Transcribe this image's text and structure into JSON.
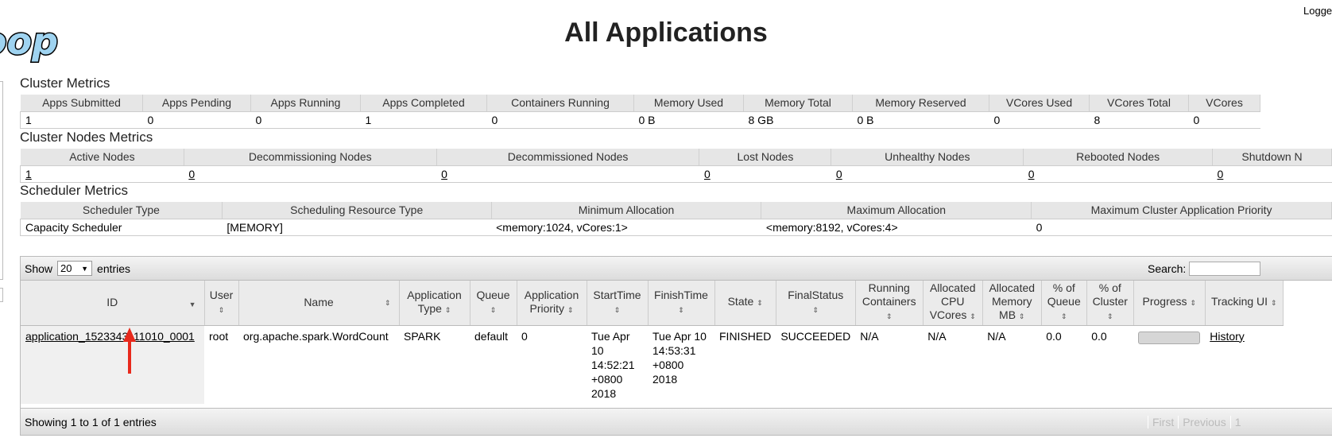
{
  "header": {
    "logo_text": "doop",
    "title": "All Applications",
    "logged_in": "Logge"
  },
  "cluster_metrics": {
    "title": "Cluster Metrics",
    "headers": [
      "Apps Submitted",
      "Apps Pending",
      "Apps Running",
      "Apps Completed",
      "Containers Running",
      "Memory Used",
      "Memory Total",
      "Memory Reserved",
      "VCores Used",
      "VCores Total",
      "VCores"
    ],
    "values": [
      "1",
      "0",
      "0",
      "1",
      "0",
      "0 B",
      "8 GB",
      "0 B",
      "0",
      "8",
      "0"
    ]
  },
  "cluster_nodes_metrics": {
    "title": "Cluster Nodes Metrics",
    "headers": [
      "Active Nodes",
      "Decommissioning Nodes",
      "Decommissioned Nodes",
      "Lost Nodes",
      "Unhealthy Nodes",
      "Rebooted Nodes",
      "Shutdown N"
    ],
    "values": [
      "1",
      "0",
      "0",
      "0",
      "0",
      "0",
      "0"
    ]
  },
  "scheduler_metrics": {
    "title": "Scheduler Metrics",
    "headers": [
      "Scheduler Type",
      "Scheduling Resource Type",
      "Minimum Allocation",
      "Maximum Allocation",
      "Maximum Cluster Application Priority"
    ],
    "values": [
      "Capacity Scheduler",
      "[MEMORY]",
      "<memory:1024, vCores:1>",
      "<memory:8192, vCores:4>",
      "0"
    ]
  },
  "apps_table": {
    "show_label": "Show",
    "entries_value": "20",
    "entries_label": "entries",
    "search_label": "Search:",
    "columns": [
      "ID",
      "User",
      "Name",
      "Application Type",
      "Queue",
      "Application Priority",
      "StartTime",
      "FinishTime",
      "State",
      "FinalStatus",
      "Running Containers",
      "Allocated CPU VCores",
      "Allocated Memory MB",
      "% of Queue",
      "% of Cluster",
      "Progress",
      "Tracking UI"
    ],
    "row": {
      "id": "application_1523343111010_0001",
      "user": "root",
      "name": "org.apache.spark.WordCount",
      "type": "SPARK",
      "queue": "default",
      "priority": "0",
      "start": "Tue Apr 10 14:52:21 +0800 2018",
      "finish": "Tue Apr 10 14:53:31 +0800 2018",
      "state": "FINISHED",
      "final_status": "SUCCEEDED",
      "running_containers": "N/A",
      "cpu_vcores": "N/A",
      "memory_mb": "N/A",
      "pct_queue": "0.0",
      "pct_cluster": "0.0",
      "tracking": "History"
    },
    "footer": "Showing 1 to 1 of 1 entries",
    "pager": [
      "First",
      "Previous",
      "1"
    ]
  },
  "colors": {
    "arrow": "#e8291c",
    "logo_fill": "#9fd3f0"
  }
}
